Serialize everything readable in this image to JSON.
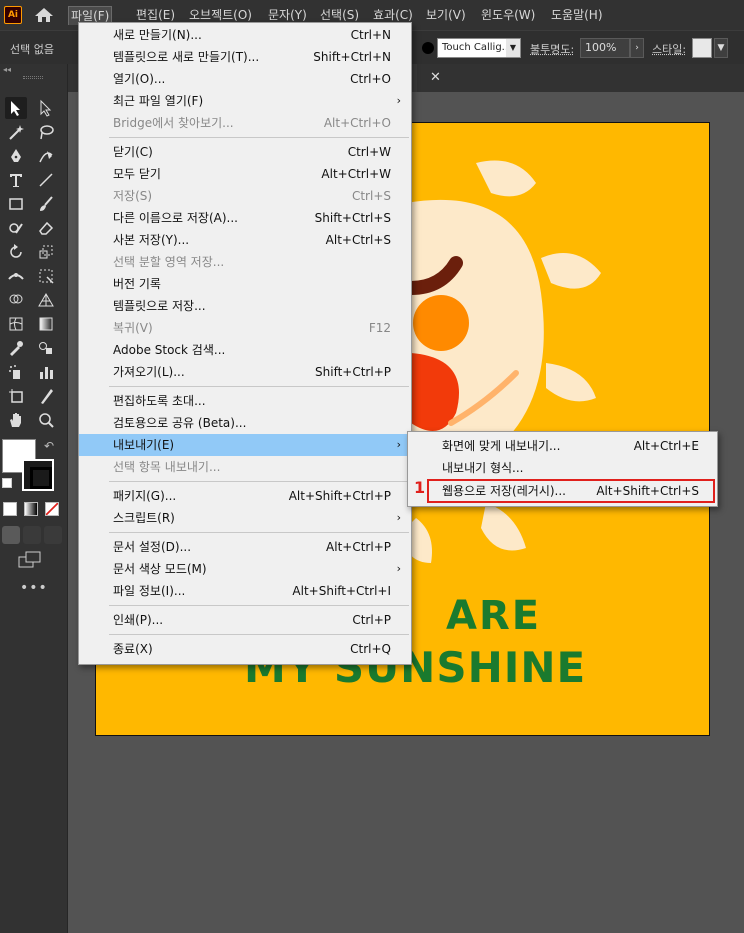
{
  "app": {
    "logo": "Ai"
  },
  "menubar": {
    "items": [
      {
        "label": "파일(F)",
        "active": true
      },
      {
        "label": "편집(E)"
      },
      {
        "label": "오브젝트(O)"
      },
      {
        "label": "문자(Y)"
      },
      {
        "label": "선택(S)"
      },
      {
        "label": "효과(C)"
      },
      {
        "label": "보기(V)"
      },
      {
        "label": "윈도우(W)"
      },
      {
        "label": "도움말(H)"
      }
    ]
  },
  "control_bar": {
    "no_selection": "선택 없음",
    "brush": "Touch Callig...",
    "opacity_label": "불투명도:",
    "opacity_value": "100%",
    "style_label": "스타일:"
  },
  "file_menu": {
    "items": [
      {
        "label": "새로 만들기(N)...",
        "shortcut": "Ctrl+N"
      },
      {
        "label": "템플릿으로 새로 만들기(T)...",
        "shortcut": "Shift+Ctrl+N"
      },
      {
        "label": "열기(O)...",
        "shortcut": "Ctrl+O"
      },
      {
        "label": "최근 파일 열기(F)",
        "submenu": "›"
      },
      {
        "label": "Bridge에서 찾아보기...",
        "shortcut": "Alt+Ctrl+O",
        "disabled": true
      },
      {
        "label": "닫기(C)",
        "shortcut": "Ctrl+W"
      },
      {
        "label": "모두 닫기",
        "shortcut": "Alt+Ctrl+W"
      },
      {
        "label": "저장(S)",
        "shortcut": "Ctrl+S",
        "disabled": true
      },
      {
        "label": "다른 이름으로 저장(A)...",
        "shortcut": "Shift+Ctrl+S"
      },
      {
        "label": "사본 저장(Y)...",
        "shortcut": "Alt+Ctrl+S"
      },
      {
        "label": "선택 분할 영역 저장...",
        "disabled": true
      },
      {
        "label": "버전 기록"
      },
      {
        "label": "템플릿으로 저장..."
      },
      {
        "label": "복귀(V)",
        "shortcut": "F12",
        "disabled": true
      },
      {
        "label": "Adobe Stock 검색..."
      },
      {
        "label": "가져오기(L)...",
        "shortcut": "Shift+Ctrl+P"
      },
      {
        "label": "편집하도록 초대..."
      },
      {
        "label": "검토용으로 공유 (Beta)..."
      },
      {
        "label": "내보내기(E)",
        "submenu": "›",
        "highlighted": true
      },
      {
        "label": "선택 항목 내보내기...",
        "disabled": true
      },
      {
        "label": "패키지(G)...",
        "shortcut": "Alt+Shift+Ctrl+P"
      },
      {
        "label": "스크립트(R)",
        "submenu": "›"
      },
      {
        "label": "문서 설정(D)...",
        "shortcut": "Alt+Ctrl+P"
      },
      {
        "label": "문서 색상 모드(M)",
        "submenu": "›"
      },
      {
        "label": "파일 정보(I)...",
        "shortcut": "Alt+Shift+Ctrl+I"
      },
      {
        "label": "인쇄(P)...",
        "shortcut": "Ctrl+P"
      },
      {
        "label": "종료(X)",
        "shortcut": "Ctrl+Q"
      }
    ]
  },
  "export_submenu": {
    "items": [
      {
        "label": "화면에 맞게 내보내기...",
        "shortcut": "Alt+Ctrl+E"
      },
      {
        "label": "내보내기 형식..."
      },
      {
        "label": "웹용으로 저장(레거시)...",
        "shortcut": "Alt+Shift+Ctrl+S",
        "annotated": true
      }
    ]
  },
  "annotation": {
    "step": "1",
    "color": "#e0201c"
  },
  "artwork": {
    "line1": "ARE",
    "line2": "MY SUNSHINE",
    "background": "#ffb800",
    "text_color": "#1a7a2e",
    "sun_color": "#fde9c9"
  },
  "colors": {
    "highlight": "#91c9f7",
    "menu_bg": "#f0f0f0",
    "ui_dark": "#323232"
  }
}
